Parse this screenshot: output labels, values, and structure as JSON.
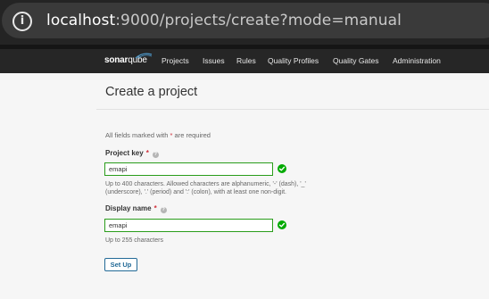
{
  "browser": {
    "url_host": "localhost",
    "url_path": ":9000/projects/create?mode=manual",
    "info_icon": "info-icon"
  },
  "navbar": {
    "logo_sonar": "sonar",
    "logo_qube": "qube",
    "items": [
      {
        "label": "Projects"
      },
      {
        "label": "Issues"
      },
      {
        "label": "Rules"
      },
      {
        "label": "Quality Profiles"
      },
      {
        "label": "Quality Gates"
      },
      {
        "label": "Administration"
      }
    ]
  },
  "page": {
    "title": "Create a project",
    "required_note_prefix": "All fields marked with ",
    "required_star": "*",
    "required_note_suffix": " are required"
  },
  "form": {
    "project_key": {
      "label": "Project key",
      "star": "*",
      "value": "emapi",
      "help_line1": "Up to 400 characters. Allowed characters are alphanumeric, '-' (dash), '_'",
      "help_line2": "(underscore), '.' (period) and ':' (colon), with at least one non-digit."
    },
    "display_name": {
      "label": "Display name",
      "star": "*",
      "value": "emapi",
      "help": "Up to 255 characters"
    },
    "submit_label": "Set Up"
  },
  "colors": {
    "valid_green": "#00aa00",
    "input_border_valid": "#2a9d1b",
    "button_blue": "#236a97",
    "required_red": "#d02f3a"
  }
}
